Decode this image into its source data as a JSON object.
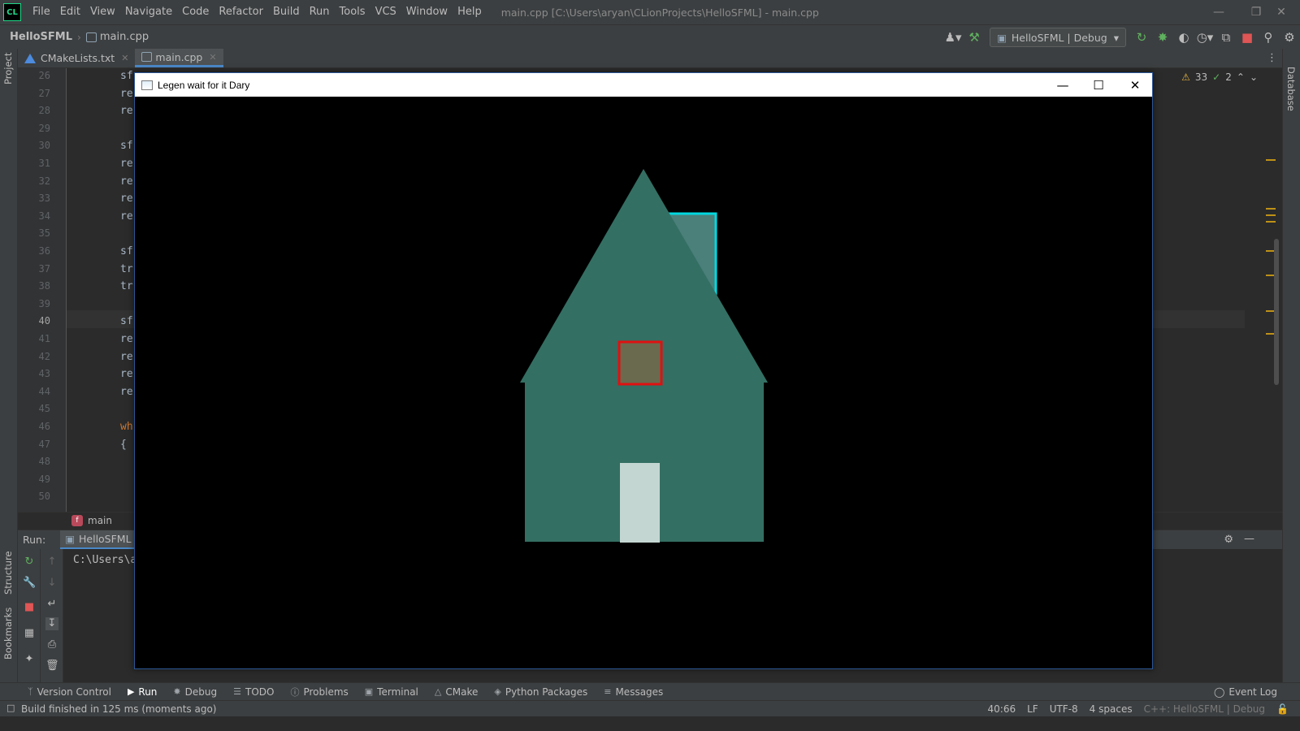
{
  "app": {
    "logo": "CL",
    "menu": [
      "File",
      "Edit",
      "View",
      "Navigate",
      "Code",
      "Refactor",
      "Build",
      "Run",
      "Tools",
      "VCS",
      "Window",
      "Help"
    ],
    "window_title": "main.cpp [C:\\Users\\aryan\\CLionProjects\\HelloSFML] - main.cpp"
  },
  "nav": {
    "project": "HelloSFML",
    "file": "main.cpp",
    "run_config": "HelloSFML | Debug"
  },
  "side_panels": {
    "project": "Project",
    "structure": "Structure",
    "bookmarks": "Bookmarks",
    "database": "Database"
  },
  "tabs": [
    {
      "label": "CMakeLists.txt",
      "active": false
    },
    {
      "label": "main.cpp",
      "active": true
    }
  ],
  "editor": {
    "line_numbers": [
      "26",
      "27",
      "28",
      "29",
      "30",
      "31",
      "32",
      "33",
      "34",
      "35",
      "36",
      "37",
      "38",
      "39",
      "40",
      "41",
      "42",
      "43",
      "44",
      "45",
      "46",
      "47",
      "48",
      "49",
      "50"
    ],
    "current_line": "40",
    "code_fragments": [
      {
        "line": "26",
        "text": "sf"
      },
      {
        "line": "27",
        "text": "re"
      },
      {
        "line": "28",
        "text": "re"
      },
      {
        "line": "30",
        "text": "sf"
      },
      {
        "line": "31",
        "text": "re"
      },
      {
        "line": "32",
        "text": "re"
      },
      {
        "line": "33",
        "text": "re"
      },
      {
        "line": "34",
        "text": "re"
      },
      {
        "line": "36",
        "text": "sf"
      },
      {
        "line": "37",
        "text": "tr"
      },
      {
        "line": "38",
        "text": "tr"
      },
      {
        "line": "40",
        "text": "sf"
      },
      {
        "line": "41",
        "text": "re"
      },
      {
        "line": "42",
        "text": "re"
      },
      {
        "line": "43",
        "text": "re"
      },
      {
        "line": "44",
        "text": "re"
      },
      {
        "line": "46",
        "text": "wh"
      },
      {
        "line": "47",
        "text": "{"
      }
    ],
    "warnings": "33",
    "checks": "2",
    "breadcrumb_function": "main"
  },
  "run_panel": {
    "label": "Run:",
    "tab": "HelloSFML",
    "console_text": "C:\\Users\\a"
  },
  "bottom_tools": [
    {
      "label": "Version Control",
      "icon": "version-control-icon",
      "active": false
    },
    {
      "label": "Run",
      "icon": "run-icon",
      "active": true
    },
    {
      "label": "Debug",
      "icon": "debug-icon",
      "active": false
    },
    {
      "label": "TODO",
      "icon": "todo-icon",
      "active": false
    },
    {
      "label": "Problems",
      "icon": "problems-icon",
      "active": false
    },
    {
      "label": "Terminal",
      "icon": "terminal-icon",
      "active": false
    },
    {
      "label": "CMake",
      "icon": "cmake-icon",
      "active": false
    },
    {
      "label": "Python Packages",
      "icon": "python-packages-icon",
      "active": false
    },
    {
      "label": "Messages",
      "icon": "messages-icon",
      "active": false
    }
  ],
  "event_log": "Event Log",
  "status": {
    "message": "Build finished in 125 ms (moments ago)",
    "position": "40:66",
    "line_sep": "LF",
    "encoding": "UTF-8",
    "indent": "4 spaces",
    "context": "C++: HelloSFML | Debug"
  },
  "sfml_window": {
    "title": "Legen wait for it Dary",
    "colors": {
      "house": "#346f63",
      "roof": "#346f63",
      "chimney_fill": "#4b7f7a",
      "chimney_outline": "#00d8e0",
      "window_fill": "#6a6a4e",
      "window_outline": "#e01010",
      "door": "#c4d6d2"
    }
  }
}
